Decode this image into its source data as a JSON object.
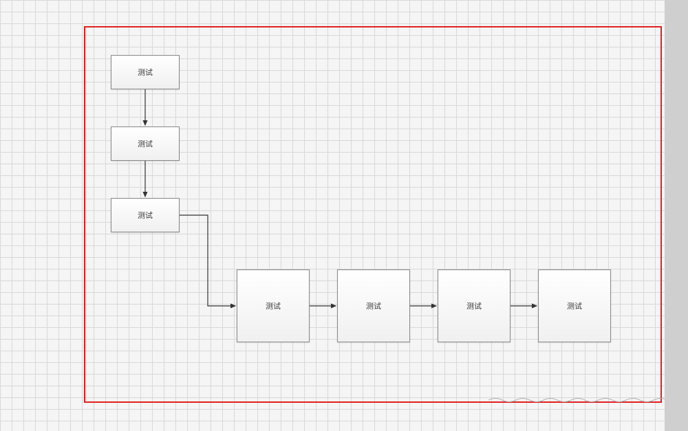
{
  "diagram": {
    "frame_color": "#e02020",
    "nodes": [
      {
        "id": "n1",
        "label": "测试"
      },
      {
        "id": "n2",
        "label": "测试"
      },
      {
        "id": "n3",
        "label": "测试"
      },
      {
        "id": "n4",
        "label": "测试"
      },
      {
        "id": "n5",
        "label": "测试"
      },
      {
        "id": "n6",
        "label": "测试"
      },
      {
        "id": "n7",
        "label": "测试"
      }
    ],
    "edges": [
      {
        "from": "n1",
        "to": "n2",
        "type": "vertical"
      },
      {
        "from": "n2",
        "to": "n3",
        "type": "vertical"
      },
      {
        "from": "n3",
        "to": "n4",
        "type": "elbow"
      },
      {
        "from": "n4",
        "to": "n5",
        "type": "horizontal"
      },
      {
        "from": "n5",
        "to": "n6",
        "type": "horizontal"
      },
      {
        "from": "n6",
        "to": "n7",
        "type": "horizontal"
      }
    ]
  }
}
